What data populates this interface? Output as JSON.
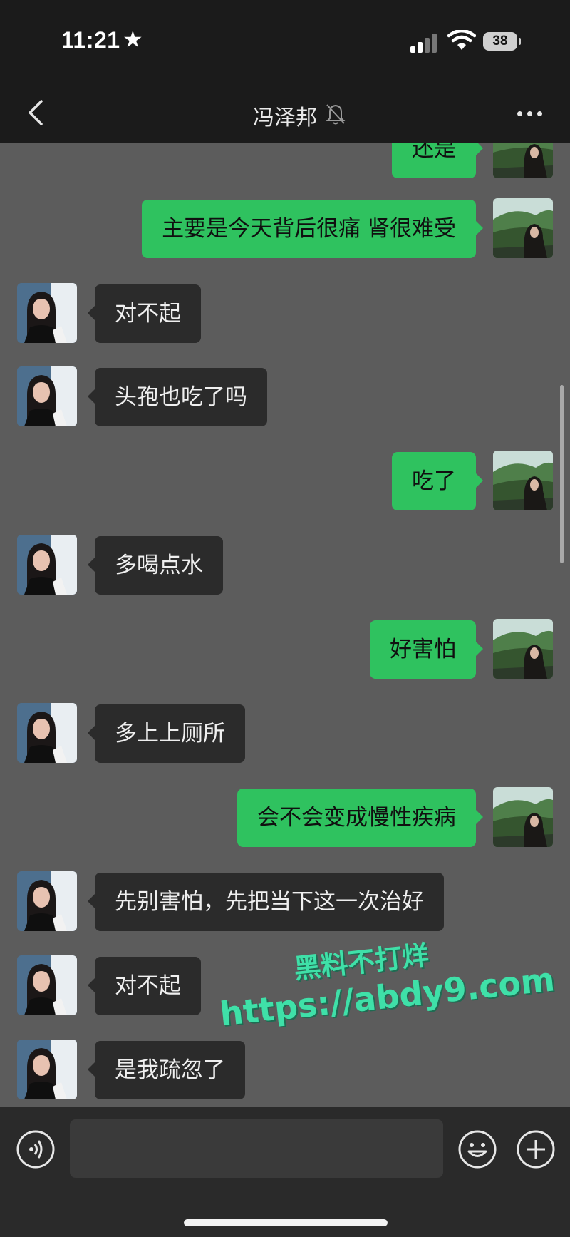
{
  "status_bar": {
    "time": "11:21",
    "star": "★",
    "battery": "38"
  },
  "header": {
    "title": "冯泽邦",
    "back_icon": "chevron-left-icon",
    "mute_icon": "bell-slash-icon",
    "more_icon": "ellipsis-icon"
  },
  "messages": [
    {
      "side": "out",
      "text": "还是"
    },
    {
      "side": "out",
      "text": "主要是今天背后很痛 肾很难受"
    },
    {
      "side": "in",
      "text": "对不起"
    },
    {
      "side": "in",
      "text": "头孢也吃了吗"
    },
    {
      "side": "out",
      "text": "吃了"
    },
    {
      "side": "in",
      "text": "多喝点水"
    },
    {
      "side": "out",
      "text": "好害怕"
    },
    {
      "side": "in",
      "text": "多上上厕所"
    },
    {
      "side": "out",
      "text": "会不会变成慢性疾病"
    },
    {
      "side": "in",
      "text": "先别害怕，先把当下这一次治好"
    },
    {
      "side": "in",
      "text": "对不起"
    },
    {
      "side": "in",
      "text": "是我疏忽了"
    }
  ],
  "watermark": {
    "line1": "黑料不打烊",
    "line2": "https://abdy9.com"
  },
  "input_bar": {
    "text_value": "",
    "voice_icon": "voice-icon",
    "emoji_icon": "emoji-icon",
    "plus_icon": "plus-icon"
  },
  "colors": {
    "outgoing_bubble": "#2fc25f",
    "incoming_bubble": "#2b2b2b",
    "chat_background": "#5c5c5c",
    "watermark": "#3fe0a8"
  }
}
